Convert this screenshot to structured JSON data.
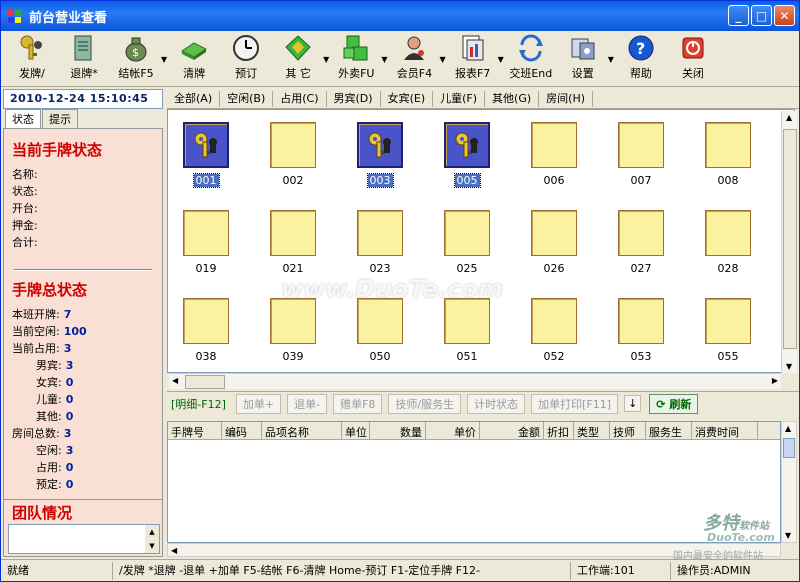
{
  "window": {
    "title": "前台营业查看"
  },
  "toolbar": [
    {
      "name": "issue-card",
      "label": "发牌/",
      "icon": "keys-icon"
    },
    {
      "name": "return-card",
      "label": "退牌*",
      "icon": "receipt-icon"
    },
    {
      "name": "checkout",
      "label": "结帐F5",
      "icon": "money-bag-icon",
      "dropdown": true
    },
    {
      "name": "clear-card",
      "label": "清牌",
      "icon": "green-bar-icon"
    },
    {
      "name": "reserve",
      "label": "预订",
      "icon": "clock-icon"
    },
    {
      "name": "other",
      "label": "其 它",
      "icon": "diamond-icon",
      "dropdown": true
    },
    {
      "name": "takeout",
      "label": "外卖FU",
      "icon": "green-cube-icon",
      "dropdown": true
    },
    {
      "name": "member",
      "label": "会员F4",
      "icon": "member-icon",
      "dropdown": true
    },
    {
      "name": "report",
      "label": "报表F7",
      "icon": "report-icon",
      "dropdown": true
    },
    {
      "name": "shift",
      "label": "交班End",
      "icon": "shift-icon"
    },
    {
      "name": "settings",
      "label": "设置",
      "icon": "settings-icon",
      "dropdown": true
    },
    {
      "name": "help",
      "label": "帮助",
      "icon": "help-icon"
    },
    {
      "name": "close",
      "label": "关闭",
      "icon": "power-icon"
    }
  ],
  "left": {
    "datetime": "2010-12-24 15:10:45",
    "tabs": [
      "状态",
      "提示"
    ],
    "current_title": "当前手牌状态",
    "current_fields": [
      "名称:",
      "状态:",
      "开台:",
      "押金:",
      "合计:"
    ],
    "total_title": "手牌总状态",
    "total_fields": [
      {
        "label": "本班开牌:",
        "value": "7",
        "indent": false
      },
      {
        "label": "当前空闲:",
        "value": "100",
        "indent": false
      },
      {
        "label": "当前占用:",
        "value": "3",
        "indent": false
      },
      {
        "label": "男宾:",
        "value": "3",
        "indent": true
      },
      {
        "label": "女宾:",
        "value": "0",
        "indent": true
      },
      {
        "label": "儿童:",
        "value": "0",
        "indent": true
      },
      {
        "label": "其他:",
        "value": "0",
        "indent": true
      },
      {
        "label": "房间总数:",
        "value": "3",
        "indent": false
      },
      {
        "label": "空闲:",
        "value": "3",
        "indent": true
      },
      {
        "label": "占用:",
        "value": "0",
        "indent": true
      },
      {
        "label": "预定:",
        "value": "0",
        "indent": true
      }
    ],
    "team_title": "团队情况"
  },
  "filters": [
    "全部(A)",
    "空闲(B)",
    "占用(C)",
    "男宾(D)",
    "女宾(E)",
    "儿童(F)",
    "其他(G)",
    "房间(H)"
  ],
  "cards": [
    [
      {
        "num": "001",
        "occupied": true
      },
      {
        "num": "002"
      },
      {
        "num": "003",
        "occupied": true
      },
      {
        "num": "005",
        "occupied": true
      },
      {
        "num": "006"
      },
      {
        "num": "007"
      },
      {
        "num": "008"
      }
    ],
    [
      {
        "num": "019"
      },
      {
        "num": "021"
      },
      {
        "num": "023"
      },
      {
        "num": "025"
      },
      {
        "num": "026"
      },
      {
        "num": "027"
      },
      {
        "num": "028"
      }
    ],
    [
      {
        "num": "038"
      },
      {
        "num": "039"
      },
      {
        "num": "050"
      },
      {
        "num": "051"
      },
      {
        "num": "052"
      },
      {
        "num": "053"
      },
      {
        "num": "055"
      }
    ]
  ],
  "actions": {
    "detail": "[明细-F12]",
    "add": "加单+",
    "return": "退单-",
    "comp": "赠单F8",
    "tech": "技师/服务生",
    "timer": "计时状态",
    "print": "加单打印[F11]",
    "down": "↓",
    "refresh": "刷新"
  },
  "table_headers": [
    "手牌号",
    "编码",
    "品项名称",
    "单位",
    "数量",
    "单价",
    "金额",
    "折扣",
    "类型",
    "技师",
    "服务生",
    "消费时间"
  ],
  "status": {
    "ready": "就绪",
    "shortcuts": "/发牌  *退牌  -退单  +加单  F5-结帐  F6-清牌  Home-预订  F1-定位手牌  F12-",
    "terminal": "工作端:101",
    "operator": "操作员:ADMIN"
  },
  "watermarks": {
    "main": "www.DuoTe.com",
    "logo1": "多特",
    "logo1b": "软件站",
    "logo2": "DuoTe.com",
    "logo3": "国内最安全的软件站"
  }
}
